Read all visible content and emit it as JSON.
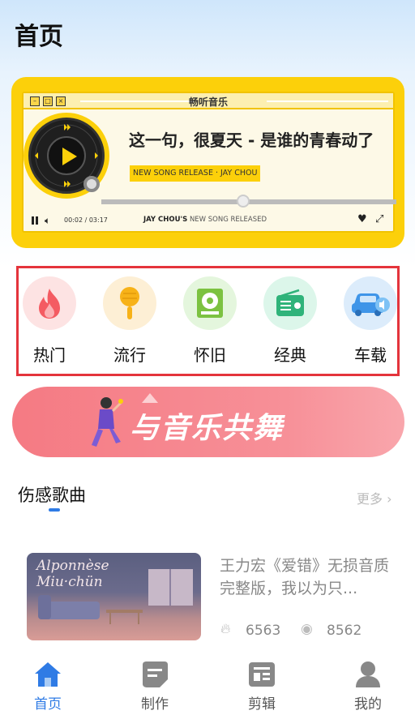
{
  "header": {
    "title": "首页"
  },
  "player": {
    "window_title": "畅听音乐",
    "song_title": "这一句，很夏天 - 是谁的青春动了",
    "release_tag": "NEW SONG RELEASE · JAY CHOU",
    "time": "00:02 / 03:17",
    "artist": "JAY CHOU'S",
    "artist_suffix": "NEW SONG RELEASED",
    "progress": 0.48,
    "colors": {
      "accent": "#fcd00a",
      "window": "#fdf9e7"
    }
  },
  "categories": [
    {
      "label": "热门",
      "icon": "flame-icon",
      "bg": "#fde3e3"
    },
    {
      "label": "流行",
      "icon": "microphone-icon",
      "bg": "#fdefd5"
    },
    {
      "label": "怀旧",
      "icon": "record-player-icon",
      "bg": "#e4f6dd"
    },
    {
      "label": "经典",
      "icon": "radio-icon",
      "bg": "#dcf6ea"
    },
    {
      "label": "车载",
      "icon": "car-icon",
      "bg": "#dcecfb"
    }
  ],
  "dance_banner": {
    "text": "与音乐共舞"
  },
  "section": {
    "title": "伤感歌曲",
    "more": "更多",
    "song": {
      "cover_text_line1": "Alponnèse",
      "cover_text_line2": "Miu·chün",
      "description": "王力宏《爱错》无损音质完整版，我以为只...",
      "likes": "6563",
      "views": "8562"
    }
  },
  "bottom_nav": [
    {
      "label": "首页",
      "icon": "home-icon",
      "active": true
    },
    {
      "label": "制作",
      "icon": "create-icon",
      "active": false
    },
    {
      "label": "剪辑",
      "icon": "edit-icon",
      "active": false
    },
    {
      "label": "我的",
      "icon": "profile-icon",
      "active": false
    }
  ]
}
